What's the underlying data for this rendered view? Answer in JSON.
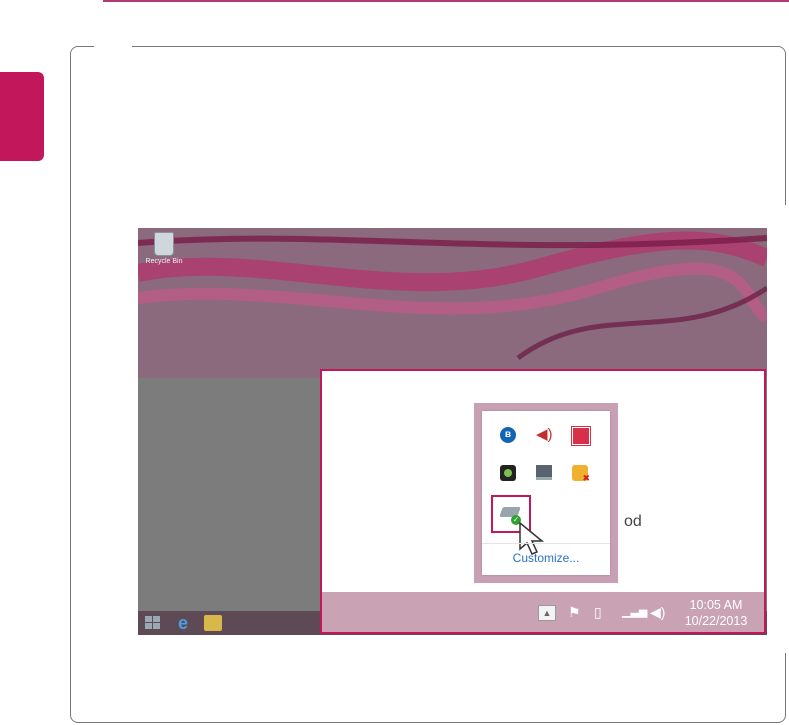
{
  "desktop": {
    "recycle_bin_label": "Recycle Bin"
  },
  "zoom_panel": {
    "partial_text": "od",
    "overflow_menu": {
      "customize_label": "Customize...",
      "icons": [
        "bluetooth-icon",
        "speaker-icon",
        "red-app-icon",
        "webcam-icon",
        "monitor-icon",
        "plug-error-icon",
        "hard-drive-safe-remove-icon"
      ]
    },
    "clock": {
      "time": "10:05 AM",
      "date": "10/22/2013"
    },
    "chevron": "▲"
  },
  "colors": {
    "accent": "#c2185b",
    "taskbar": "#c9a2b4",
    "link": "#2a70c8"
  }
}
